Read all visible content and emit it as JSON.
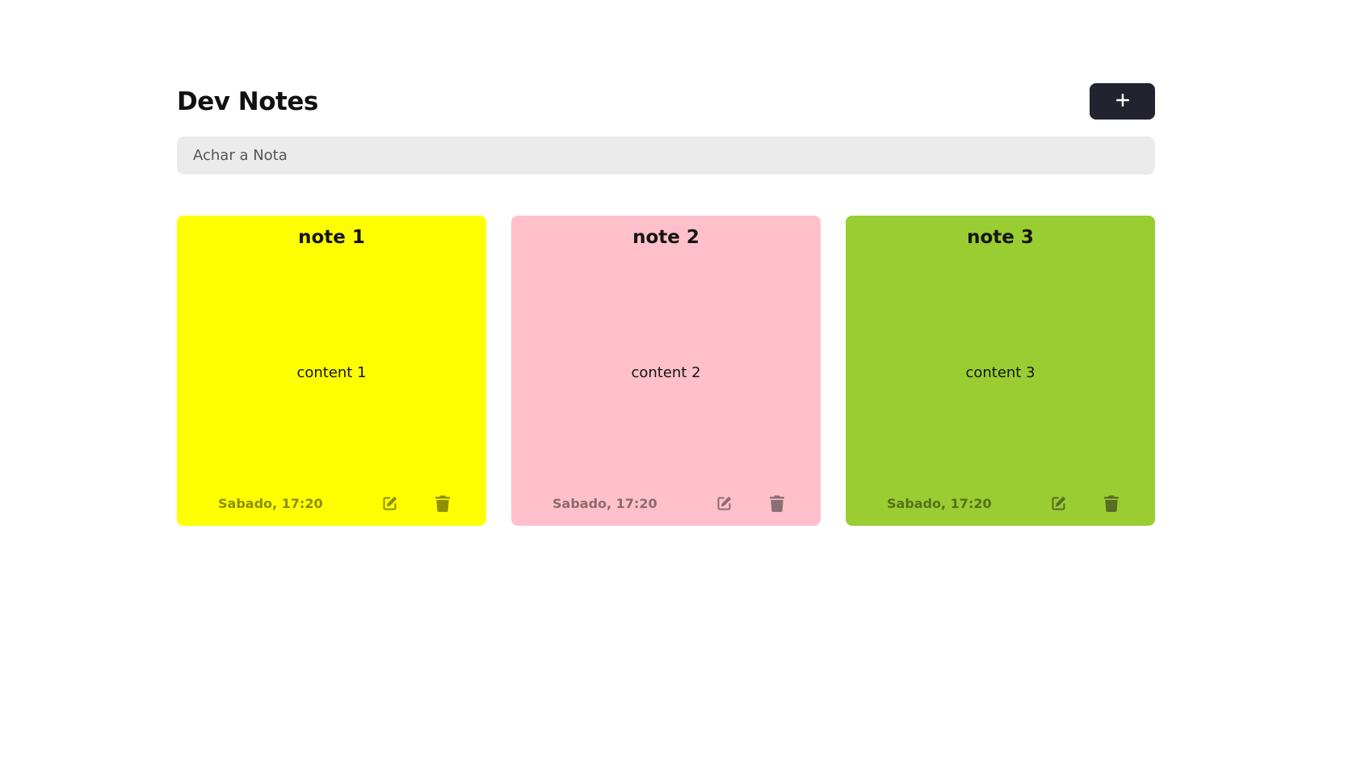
{
  "app": {
    "title": "Dev Notes",
    "add_button_icon": "plus-icon"
  },
  "search": {
    "placeholder": "Achar a Nota",
    "value": ""
  },
  "notes": [
    {
      "title": "note 1",
      "content": "content 1",
      "date": "Sabado, 17:20",
      "color": "#ffff00",
      "icon_color": "#8f8f00",
      "edit_icon": "edit-icon",
      "delete_icon": "trash-icon"
    },
    {
      "title": "note 2",
      "content": "content 2",
      "date": "Sabado, 17:20",
      "color": "#ffc0cb",
      "icon_color": "#8a6f74",
      "edit_icon": "edit-icon",
      "delete_icon": "trash-icon"
    },
    {
      "title": "note 3",
      "content": "content 3",
      "date": "Sabado, 17:20",
      "color": "#9acd32",
      "icon_color": "#566f23",
      "edit_icon": "edit-icon",
      "delete_icon": "trash-icon"
    }
  ]
}
